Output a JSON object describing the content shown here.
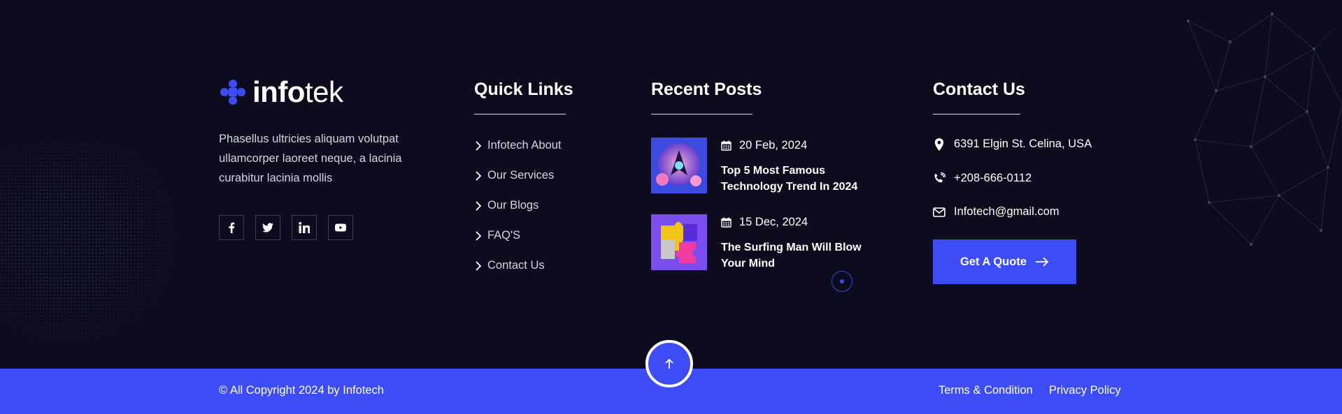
{
  "brand": {
    "name_bold": "info",
    "name_light": "tek",
    "accent": "#3d4cf5"
  },
  "about": {
    "text": "Phasellus ultricies aliquam volutpat ullamcorper laoreet neque, a lacinia curabitur lacinia mollis"
  },
  "social": [
    "facebook-icon",
    "twitter-icon",
    "linkedin-icon",
    "youtube-icon"
  ],
  "quick_links": {
    "heading": "Quick Links",
    "items": [
      "Infotech About",
      "Our Services",
      "Our Blogs",
      "FAQ'S",
      "Contact Us"
    ]
  },
  "recent_posts": {
    "heading": "Recent Posts",
    "items": [
      {
        "date": "20 Feb, 2024",
        "title": "Top 5 Most Famous Technology Trend In 2024"
      },
      {
        "date": "15 Dec, 2024",
        "title": "The Surfing Man Will Blow Your Mind"
      }
    ]
  },
  "contact": {
    "heading": "Contact Us",
    "address": "6391 Elgin St. Celina, USA",
    "phone": "+208-666-0112",
    "email": "Infotech@gmail.com",
    "cta": "Get A Quote"
  },
  "bottom": {
    "copyright": "© All Copyright 2024 by Infotech",
    "terms": "Terms & Condition",
    "privacy": "Privacy Policy"
  }
}
